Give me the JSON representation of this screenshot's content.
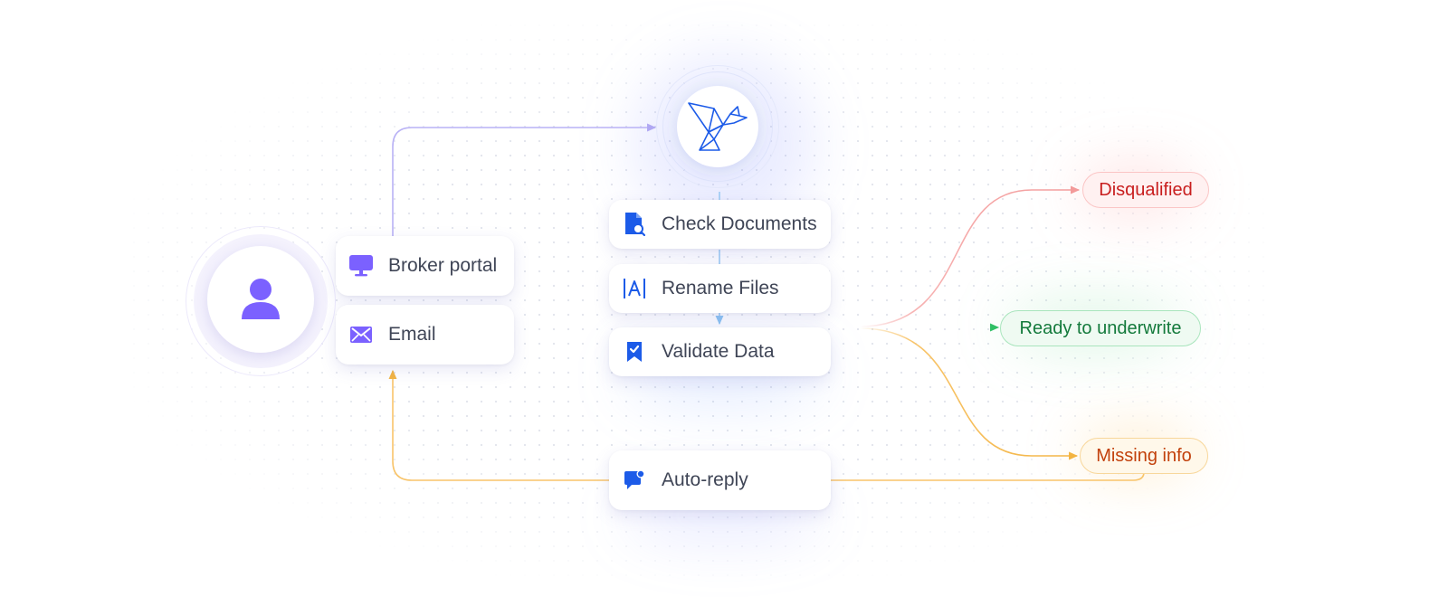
{
  "sources": {
    "broker_portal": {
      "label": "Broker portal",
      "icon": "monitor-icon"
    },
    "email": {
      "label": "Email",
      "icon": "envelope-icon"
    }
  },
  "user": {
    "icon": "user-icon"
  },
  "processor": {
    "icon": "origami-bird-logo-icon"
  },
  "steps": [
    {
      "label": "Check Documents",
      "icon": "document-search-icon"
    },
    {
      "label": "Rename Files",
      "icon": "text-cursor-icon"
    },
    {
      "label": "Validate Data",
      "icon": "bookmark-check-icon"
    }
  ],
  "auto_reply": {
    "label": "Auto-reply",
    "icon": "chat-notification-icon"
  },
  "outcomes": {
    "disqualified": {
      "label": "Disqualified",
      "color": "#c81e1e"
    },
    "ready": {
      "label": "Ready to underwrite",
      "color": "#147a3c"
    },
    "missing": {
      "label": "Missing info",
      "color": "#c2410c"
    }
  },
  "colors": {
    "accent_purple": "#7b61ff",
    "accent_blue": "#1c5be8",
    "wire_purple": "#b9b2f5",
    "wire_blue": "#9ccbf4",
    "wire_red": "#f7b2b2",
    "wire_green": "#39c46e",
    "wire_orange": "#f8c46a"
  }
}
